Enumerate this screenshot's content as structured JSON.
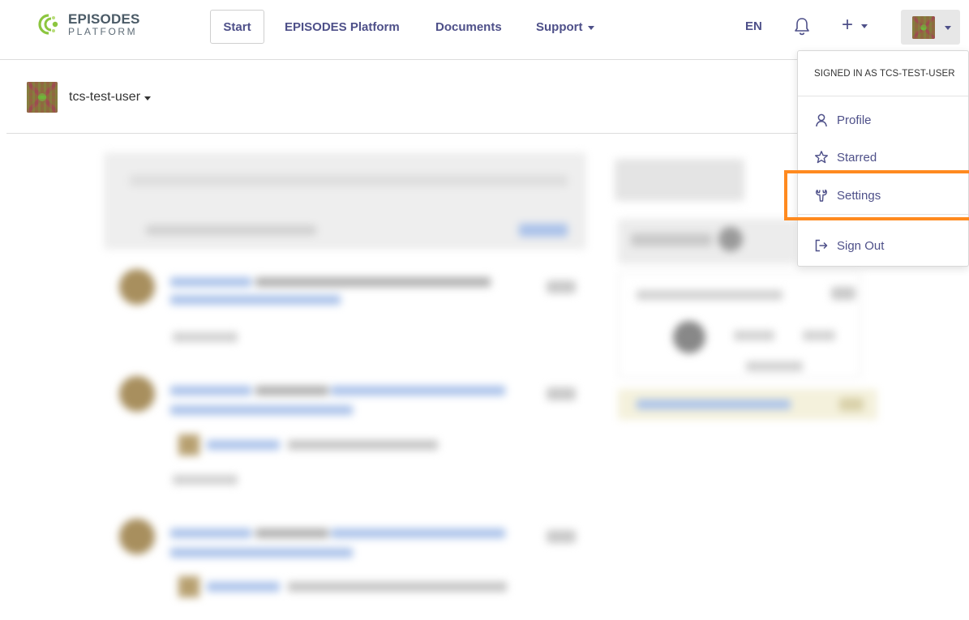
{
  "logo": {
    "line1": "EPISODES",
    "line2": "PLATFORM"
  },
  "nav": {
    "start": "Start",
    "episodes_platform": "EPISODES Platform",
    "documents": "Documents",
    "support": "Support",
    "language": "EN",
    "notifications_icon": "bell-icon",
    "create_icon": "plus-icon"
  },
  "userbar": {
    "username": "tcs-test-user"
  },
  "user_menu": {
    "header": "SIGNED IN AS TCS-TEST-USER",
    "items": [
      {
        "label": "Profile",
        "icon": "person-icon"
      },
      {
        "label": "Starred",
        "icon": "star-icon"
      },
      {
        "label": "Settings",
        "icon": "wrench-icon"
      },
      {
        "label": "Sign Out",
        "icon": "sign-out-icon"
      }
    ]
  },
  "colors": {
    "nav_link": "#4e5089",
    "highlight": "#ff8a1f",
    "logo_green": "#8cc63f"
  }
}
